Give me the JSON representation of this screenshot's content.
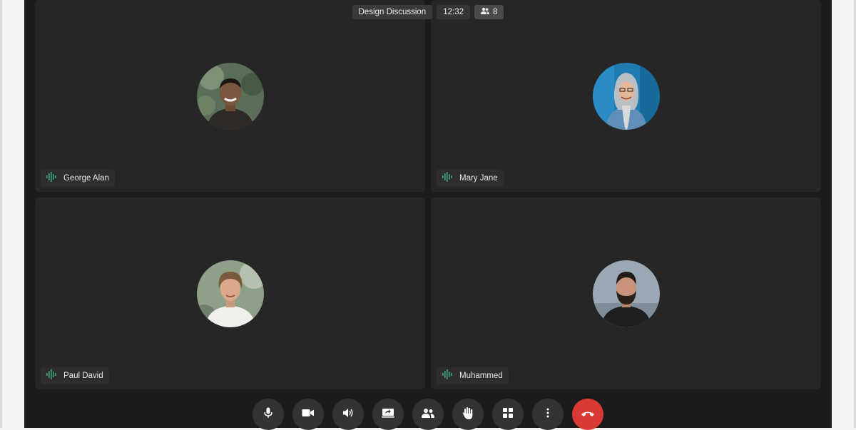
{
  "meeting": {
    "title": "Design Discussion",
    "time": "12:32",
    "participants_count": "8",
    "participants_icon": "people-icon"
  },
  "participants": [
    {
      "name": "George Alan",
      "status_icon": "audio-wave-icon"
    },
    {
      "name": "Mary Jane",
      "status_icon": "audio-wave-icon"
    },
    {
      "name": "Paul David",
      "status_icon": "audio-wave-icon"
    },
    {
      "name": "Muhammed",
      "status_icon": "audio-wave-icon"
    }
  ],
  "controls": [
    {
      "icon": "microphone-icon"
    },
    {
      "icon": "video-camera-icon"
    },
    {
      "icon": "speaker-icon"
    },
    {
      "icon": "screen-share-icon"
    },
    {
      "icon": "participants-icon"
    },
    {
      "icon": "raise-hand-icon"
    },
    {
      "icon": "grid-layout-icon"
    },
    {
      "icon": "more-options-icon"
    },
    {
      "icon": "end-call-icon"
    }
  ],
  "colors": {
    "background": "#1b1b1b",
    "tile": "#262626",
    "audio_wave": "#3ea37a",
    "end_call": "#d93a35"
  }
}
